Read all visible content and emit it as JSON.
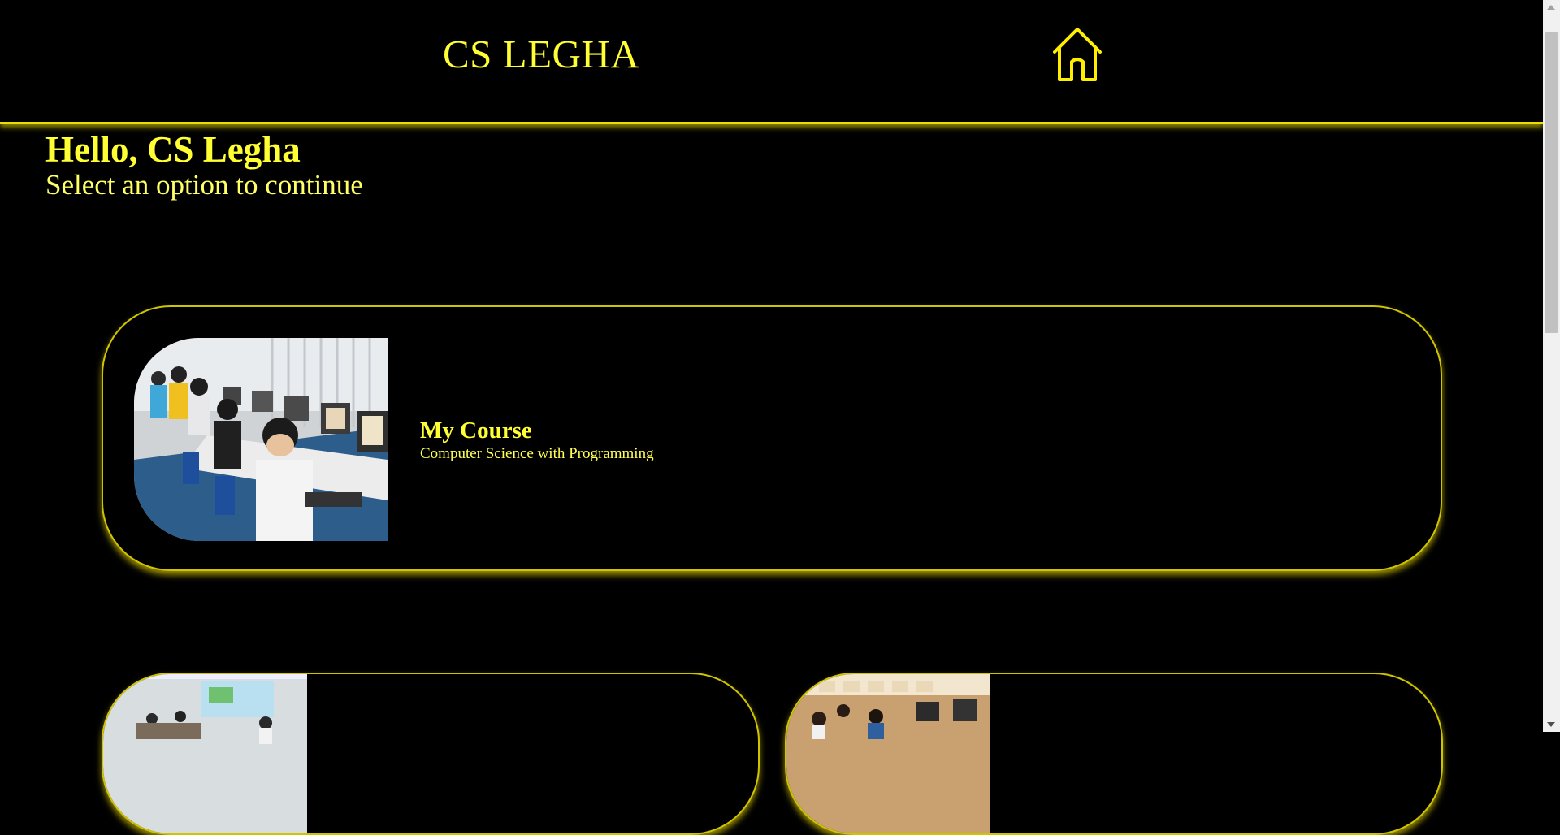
{
  "header": {
    "brand": "CS LEGHA",
    "home_icon": "home-icon"
  },
  "welcome": {
    "greeting": "Hello, CS Legha",
    "subtitle": "Select an option to continue"
  },
  "cards": [
    {
      "title": "My Course",
      "description": "Computer Science with Programming",
      "image": "students-at-computers-photo"
    },
    {
      "image": "classroom-presentation-photo"
    },
    {
      "image": "computer-lab-students-photo"
    }
  ],
  "colors": {
    "background": "#000000",
    "accent": "#ffff00"
  }
}
